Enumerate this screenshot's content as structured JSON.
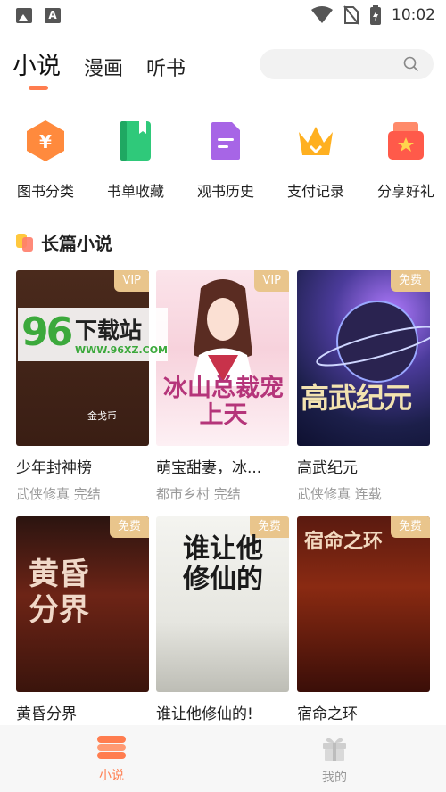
{
  "status_bar": {
    "time": "10:02"
  },
  "top_tabs": [
    {
      "label": "小说",
      "active": true
    },
    {
      "label": "漫画",
      "active": false
    },
    {
      "label": "听书",
      "active": false
    }
  ],
  "search": {
    "icon": "search-icon"
  },
  "categories": [
    {
      "label": "图书分类",
      "icon": "hexagon-yen-icon",
      "color": "#ff8a3d"
    },
    {
      "label": "书单收藏",
      "icon": "book-icon",
      "color": "#2fc97a"
    },
    {
      "label": "观书历史",
      "icon": "document-icon",
      "color": "#a765e6"
    },
    {
      "label": "支付记录",
      "icon": "crown-icon",
      "color": "#ffb020"
    },
    {
      "label": "分享好礼",
      "icon": "gift-star-icon",
      "color": "#ff5a4a"
    }
  ],
  "section": {
    "title": "长篇小说"
  },
  "books": [
    {
      "name": "少年封神榜",
      "meta": "武侠修真 完结",
      "badge": "VIP",
      "cover_text": "金戈币"
    },
    {
      "name": "萌宝甜妻，冰...",
      "meta": "都市乡村 完结",
      "badge": "VIP",
      "cover_text": "冰山总裁宠上天"
    },
    {
      "name": "高武纪元",
      "meta": "武侠修真 连载",
      "badge": "免费",
      "cover_text": "高武纪元"
    },
    {
      "name": "黄昏分界",
      "meta": "",
      "badge": "免费",
      "cover_text": "黄昏分界"
    },
    {
      "name": "谁让他修仙的!",
      "meta": "",
      "badge": "免费",
      "cover_text": "谁让他修仙的"
    },
    {
      "name": "宿命之环",
      "meta": "",
      "badge": "免费",
      "cover_text": "宿命之环"
    }
  ],
  "watermark": {
    "number": "96",
    "site": "下载站",
    "url": "WWW.96XZ.COM"
  },
  "bottom_nav": [
    {
      "label": "小说",
      "active": true,
      "color": "#ff7d4f"
    },
    {
      "label": "我的",
      "active": false,
      "color": "#999999"
    }
  ]
}
